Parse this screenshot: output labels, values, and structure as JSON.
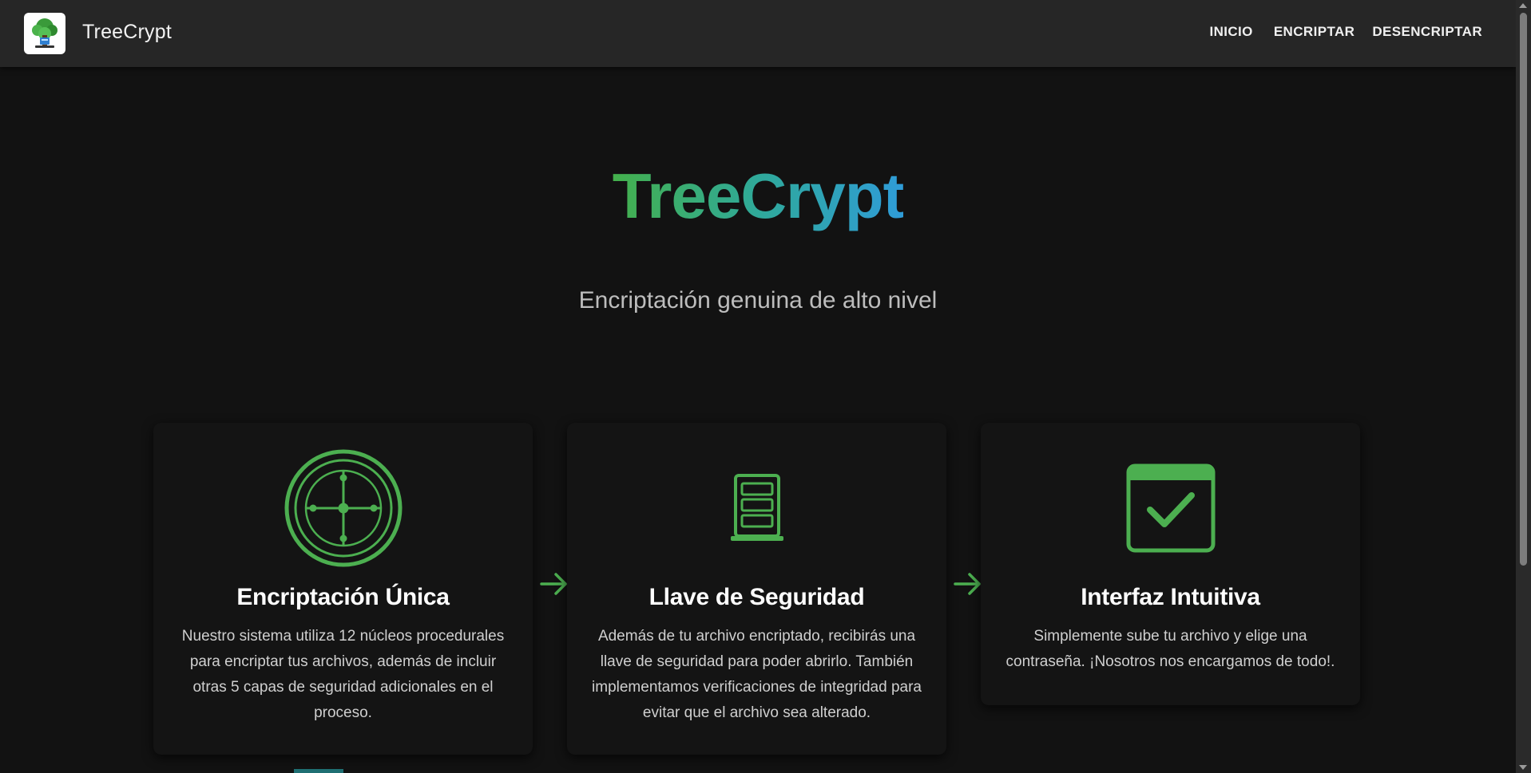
{
  "navbar": {
    "brand": "TreeCrypt",
    "links": [
      "INICIO",
      "ENCRIPTAR",
      "DESENCRIPTAR"
    ]
  },
  "hero": {
    "title": "TreeCrypt",
    "subtitle": "Encriptación genuina de alto nivel"
  },
  "features": [
    {
      "title": "Encriptación Única",
      "text": "Nuestro sistema utiliza 12 núcleos procedurales para encriptar tus archivos, además de incluir otras 5 capas de seguridad adicionales en el proceso."
    },
    {
      "title": "Llave de Seguridad",
      "text": "Además de tu archivo encriptado, recibirás una llave de seguridad para poder abrirlo. También implementamos verificaciones de integridad para evitar que el archivo sea alterado."
    },
    {
      "title": "Interfaz Intuitiva",
      "text": "Simplemente sube tu archivo y elige una contraseña. ¡Nosotros nos encargamos de todo!."
    }
  ],
  "icons": {
    "logo": "tree-logo-icon",
    "feature1": "vault-dial-icon",
    "feature2": "server-rack-icon",
    "feature3": "checkbox-calendar-icon",
    "arrow": "arrow-right-icon"
  },
  "colors": {
    "accent_green": "#4caf50",
    "gradient_start": "#44b04c",
    "gradient_end": "#2f9cd8",
    "background": "#121212",
    "navbar": "#262626"
  }
}
